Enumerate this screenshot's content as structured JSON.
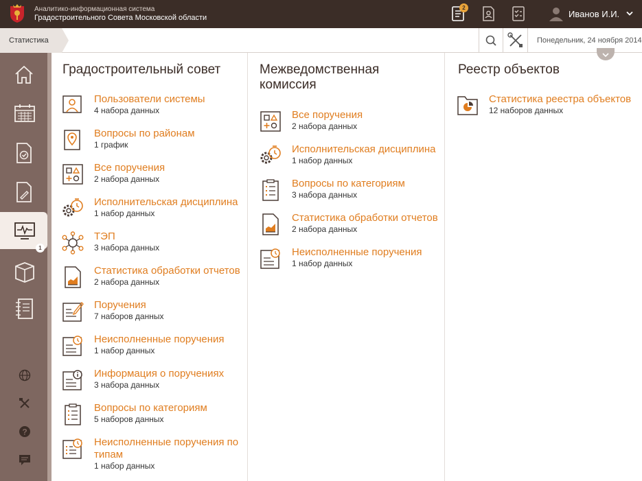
{
  "header": {
    "app_title_line1": "Аналитико-информационная система",
    "app_title_line2": "Градостроительного Совета Московской области",
    "notifications_badge": "2",
    "user_name": "Иванов И.И.",
    "icons": [
      "document-list-icon",
      "document-person-icon",
      "checklist-icon",
      "user-avatar-icon",
      "chevron-down-icon"
    ]
  },
  "toolbar": {
    "breadcrumb": "Статистика",
    "date": "Понедельник, 24 ноября 2014"
  },
  "sidebar": {
    "items": [
      {
        "icon": "home-icon"
      },
      {
        "icon": "calendar-icon"
      },
      {
        "icon": "document-check-icon"
      },
      {
        "icon": "document-edit-icon"
      },
      {
        "icon": "monitor-pulse-icon",
        "active": true
      },
      {
        "icon": "book-icon"
      },
      {
        "icon": "notebook-icon",
        "badge": "1"
      }
    ],
    "small_items": [
      "globe-icon",
      "tools-icon",
      "help-icon",
      "chat-icon"
    ]
  },
  "columns": [
    {
      "title": "Градостроительный совет",
      "items": [
        {
          "label": "Пользователи системы",
          "sub": "4 набора данных",
          "icon": "users-icon"
        },
        {
          "label": "Вопросы по районам",
          "sub": "1 график",
          "icon": "map-pin-icon"
        },
        {
          "label": "Все поручения",
          "sub": "2 набора данных",
          "icon": "shapes-icon"
        },
        {
          "label": "Исполнительская дисциплина",
          "sub": "1 набор данных",
          "icon": "gear-timer-icon"
        },
        {
          "label": "ТЭП",
          "sub": "3 набора данных",
          "icon": "network-icon"
        },
        {
          "label": "Статистика обработки отчетов",
          "sub": "2 набора данных",
          "icon": "report-chart-icon"
        },
        {
          "label": "Поручения",
          "sub": "7 наборов данных",
          "icon": "edit-list-icon"
        },
        {
          "label": "Неисполненные поручения",
          "sub": "1 набор данных",
          "icon": "clock-list-icon"
        },
        {
          "label": "Информация о поручениях",
          "sub": "3 набора данных",
          "icon": "info-list-icon"
        },
        {
          "label": "Вопросы по категориям",
          "sub": "5 наборов данных",
          "icon": "clipboard-list-icon"
        },
        {
          "label": "Неисполненные поручения по типам",
          "sub": "1 набор данных",
          "icon": "clock-board-icon"
        }
      ]
    },
    {
      "title": "Межведомственная комиссия",
      "items": [
        {
          "label": "Все поручения",
          "sub": "2 набора данных",
          "icon": "shapes-icon"
        },
        {
          "label": "Исполнительская дисциплина",
          "sub": "1 набор данных",
          "icon": "gear-timer-icon"
        },
        {
          "label": "Вопросы по категориям",
          "sub": "3 набора данных",
          "icon": "clipboard-list-icon"
        },
        {
          "label": "Статистика обработки отчетов",
          "sub": "2 набора данных",
          "icon": "report-chart-icon"
        },
        {
          "label": "Неисполненные поручения",
          "sub": "1 набор данных",
          "icon": "clock-list-icon"
        }
      ]
    },
    {
      "title": "Реестр объектов",
      "items": [
        {
          "label": "Статистика реестра объектов",
          "sub": "12 наборов данных",
          "icon": "folder-pie-icon"
        }
      ]
    }
  ],
  "colors": {
    "header_bg": "#3b2d27",
    "sidebar_bg": "#7e6760",
    "accent_orange": "#e07d1f",
    "icon_dark": "#4a3b35"
  }
}
